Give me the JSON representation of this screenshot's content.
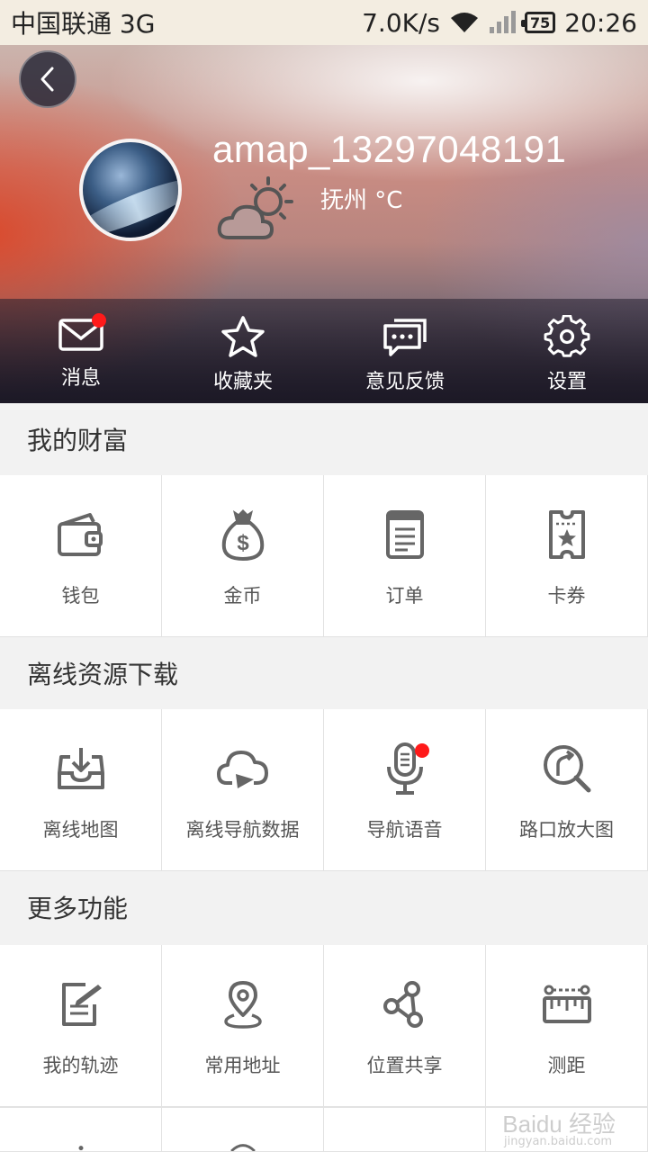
{
  "status_bar": {
    "carrier": "中国联通 3G",
    "speed": "7.0K/s",
    "battery": "75",
    "time": "20:26"
  },
  "header": {
    "username": "amap_13297048191",
    "city_weather": "抚州 °C",
    "quick_actions": [
      {
        "label": "消息",
        "icon": "mail-icon",
        "badge": true
      },
      {
        "label": "收藏夹",
        "icon": "star-icon",
        "badge": false
      },
      {
        "label": "意见反馈",
        "icon": "feedback-icon",
        "badge": false
      },
      {
        "label": "设置",
        "icon": "gear-icon",
        "badge": false
      }
    ]
  },
  "sections": [
    {
      "title": "我的财富",
      "items": [
        {
          "label": "钱包",
          "icon": "wallet-icon"
        },
        {
          "label": "金币",
          "icon": "money-bag-icon"
        },
        {
          "label": "订单",
          "icon": "order-icon"
        },
        {
          "label": "卡券",
          "icon": "coupon-icon"
        }
      ]
    },
    {
      "title": "离线资源下载",
      "items": [
        {
          "label": "离线地图",
          "icon": "download-tray-icon"
        },
        {
          "label": "离线导航数据",
          "icon": "cloud-nav-icon"
        },
        {
          "label": "导航语音",
          "icon": "microphone-icon",
          "badge": true
        },
        {
          "label": "路口放大图",
          "icon": "junction-zoom-icon"
        }
      ]
    },
    {
      "title": "更多功能",
      "items": [
        {
          "label": "我的轨迹",
          "icon": "track-icon"
        },
        {
          "label": "常用地址",
          "icon": "location-pin-icon"
        },
        {
          "label": "位置共享",
          "icon": "share-icon"
        },
        {
          "label": "测距",
          "icon": "ruler-icon"
        }
      ]
    }
  ],
  "watermark": {
    "main": "Baidu 经验",
    "sub": "jingyan.baidu.com"
  },
  "colors": {
    "icon": "#666666",
    "badge": "#ff1a1a",
    "status_bg": "#f3ede1"
  }
}
